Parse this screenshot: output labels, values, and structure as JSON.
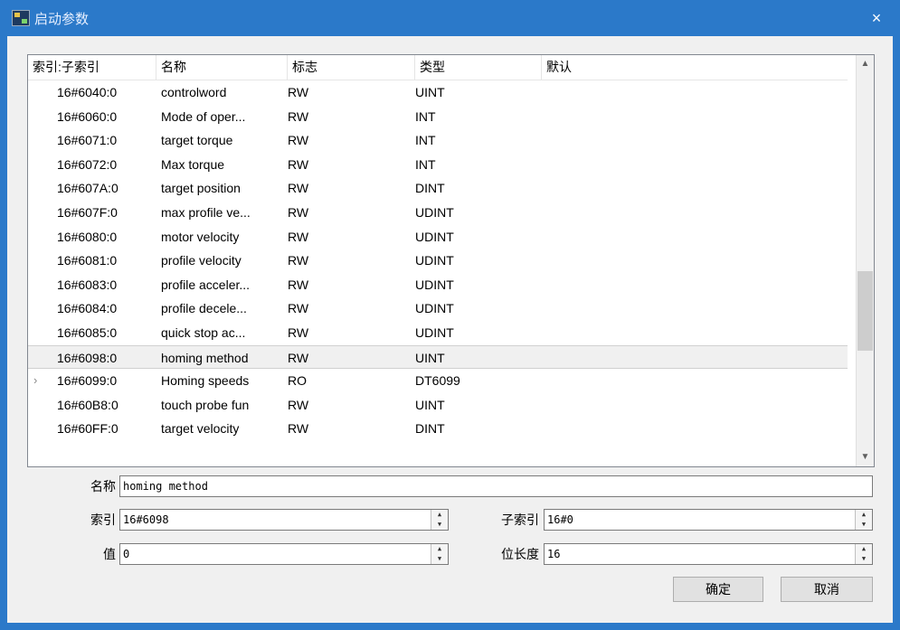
{
  "window": {
    "title": "启动参数",
    "close_glyph": "×"
  },
  "table": {
    "columns": [
      "索引:子索引",
      "名称",
      "标志",
      "类型",
      "默认"
    ],
    "rows": [
      {
        "index": "16#6040:0",
        "name": "controlword",
        "flag": "RW",
        "type": "UINT",
        "default": ""
      },
      {
        "index": "16#6060:0",
        "name": "Mode of oper...",
        "flag": "RW",
        "type": "INT",
        "default": ""
      },
      {
        "index": "16#6071:0",
        "name": "target torque",
        "flag": "RW",
        "type": "INT",
        "default": ""
      },
      {
        "index": "16#6072:0",
        "name": "Max torque",
        "flag": "RW",
        "type": "INT",
        "default": ""
      },
      {
        "index": "16#607A:0",
        "name": "target position",
        "flag": "RW",
        "type": "DINT",
        "default": ""
      },
      {
        "index": "16#607F:0",
        "name": "max profile ve...",
        "flag": "RW",
        "type": "UDINT",
        "default": ""
      },
      {
        "index": "16#6080:0",
        "name": "motor velocity",
        "flag": "RW",
        "type": "UDINT",
        "default": ""
      },
      {
        "index": "16#6081:0",
        "name": "profile velocity",
        "flag": "RW",
        "type": "UDINT",
        "default": ""
      },
      {
        "index": "16#6083:0",
        "name": "profile acceler...",
        "flag": "RW",
        "type": "UDINT",
        "default": ""
      },
      {
        "index": "16#6084:0",
        "name": "profile decele...",
        "flag": "RW",
        "type": "UDINT",
        "default": ""
      },
      {
        "index": "16#6085:0",
        "name": "quick stop ac...",
        "flag": "RW",
        "type": "UDINT",
        "default": ""
      },
      {
        "index": "16#6098:0",
        "name": "homing method",
        "flag": "RW",
        "type": "UINT",
        "default": "",
        "selected": true
      },
      {
        "index": "16#6099:0",
        "name": "Homing speeds",
        "flag": "RO",
        "type": "DT6099",
        "default": "",
        "expandable": true
      },
      {
        "index": "16#60B8:0",
        "name": "touch probe fun",
        "flag": "RW",
        "type": "UINT",
        "default": ""
      },
      {
        "index": "16#60FF:0",
        "name": "target velocity",
        "flag": "RW",
        "type": "DINT",
        "default": ""
      }
    ],
    "expand_glyph": "›",
    "scroll_up_glyph": "▲",
    "scroll_down_glyph": "▼",
    "scroll_position": 0.67
  },
  "form": {
    "name_label": "名称",
    "name_value": "homing method",
    "index_label": "索引",
    "index_value": "16#6098",
    "subindex_label": "子索引",
    "subindex_value": "16#0",
    "value_label": "值",
    "value_value": "0",
    "bitlen_label": "位长度",
    "bitlen_value": "16",
    "spin_up": "▲",
    "spin_down": "▼"
  },
  "buttons": {
    "ok": "确定",
    "cancel": "取消"
  }
}
